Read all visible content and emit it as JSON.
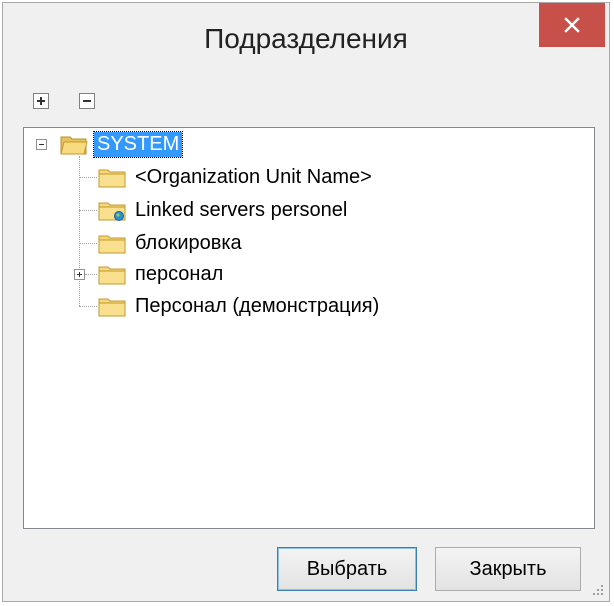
{
  "window": {
    "title": "Подразделения"
  },
  "toolbar": {
    "expand_all_icon": "plus-box-icon",
    "collapse_all_icon": "minus-box-icon"
  },
  "tree": {
    "root": {
      "label": "SYSTEM",
      "expanded": true,
      "selected": true
    },
    "children": [
      {
        "label": "<Organization Unit Name>",
        "icon": "folder-icon"
      },
      {
        "label": "Linked servers personel",
        "icon": "folder-linked-icon"
      },
      {
        "label": "блокировка",
        "icon": "folder-icon"
      },
      {
        "label": "персонал",
        "icon": "folder-icon",
        "expandable": true
      },
      {
        "label": "Персонал (демонстрация)",
        "icon": "folder-icon"
      }
    ]
  },
  "buttons": {
    "select": "Выбрать",
    "close": "Закрыть"
  },
  "colors": {
    "selection": "#3399ff",
    "close_button": "#c7504a",
    "folder": "#f5d77a"
  }
}
